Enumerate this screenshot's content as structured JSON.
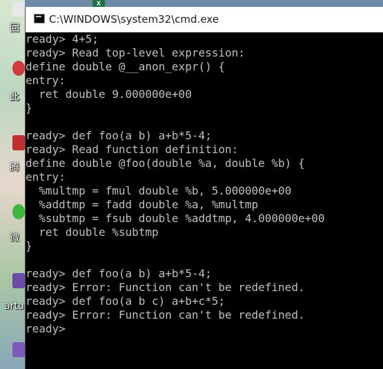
{
  "window": {
    "title": "C:\\WINDOWS\\system32\\cmd.exe"
  },
  "desktop": {
    "labels": [
      "回",
      "此",
      "腾",
      "微",
      "artu"
    ],
    "taskbar_peek": "X"
  },
  "colors": {
    "console_bg": "#000000",
    "console_text": "#c0c0c0",
    "titlebar_bg": "#ffffff"
  },
  "console": {
    "lines": [
      "ready> 4+5;",
      "ready> Read top-level expression:",
      "define double @__anon_expr() {",
      "entry:",
      "  ret double 9.000000e+00",
      "}",
      "",
      "ready> def foo(a b) a+b*5-4;",
      "ready> Read function definition:",
      "define double @foo(double %a, double %b) {",
      "entry:",
      "  %multmp = fmul double %b, 5.000000e+00",
      "  %addtmp = fadd double %a, %multmp",
      "  %subtmp = fsub double %addtmp, 4.000000e+00",
      "  ret double %subtmp",
      "}",
      "",
      "ready> def foo(a b) a+b*5-4;",
      "ready> Error: Function can't be redefined.",
      "ready> def foo(a b c) a+b+c*5;",
      "ready> Error: Function can't be redefined.",
      "ready>"
    ]
  }
}
